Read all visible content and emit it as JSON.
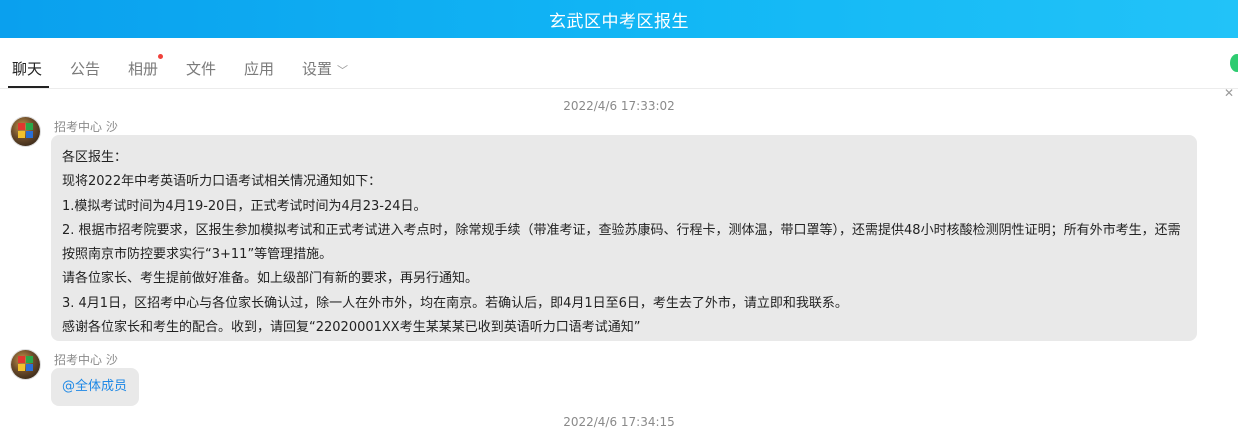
{
  "window": {
    "title": "玄武区中考区报生"
  },
  "tabs": [
    {
      "label": "聊天"
    },
    {
      "label": "公告"
    },
    {
      "label": "相册"
    },
    {
      "label": "文件"
    },
    {
      "label": "应用"
    },
    {
      "label": "设置"
    }
  ],
  "chat": {
    "timestamps": [
      "2022/4/6 17:33:02",
      "2022/4/6 17:34:15"
    ],
    "messages": [
      {
        "sender": "招考中心 沙",
        "lines": [
          "各区报生：",
          "现将2022年中考英语听力口语考试相关情况通知如下：",
          "1.模拟考试时间为4月19-20日，正式考试时间为4月23-24日。",
          "2. 根据市招考院要求，区报生参加模拟考试和正式考试进入考点时，除常规手续（带准考证，查验苏康码、行程卡，测体温，带口罩等），还需提供48小时核酸检测阴性证明；所有外市考生，还需",
          "按照南京市防控要求实行“3+11”等管理措施。",
          "请各位家长、考生提前做好准备。如上级部门有新的要求，再另行通知。",
          "3. 4月1日，区招考中心与各位家长确认过，除一人在外市外，均在南京。若确认后，即4月1日至6日，考生去了外市，请立即和我联系。",
          "感谢各位家长和考生的配合。收到，请回复“22020001XX考生某某某已收到英语听力口语考试通知”"
        ]
      },
      {
        "sender": "招考中心 沙",
        "text": "@全体成员"
      }
    ]
  },
  "icons": {
    "settings_chevron": "chevron-down-icon",
    "close": "close-icon",
    "avatar": "avatar-image"
  },
  "colors": {
    "titlebar": "#12b7f5",
    "bubble": "#e9e9e9",
    "mention": "#1e88e5",
    "badge": "#f0413b"
  }
}
